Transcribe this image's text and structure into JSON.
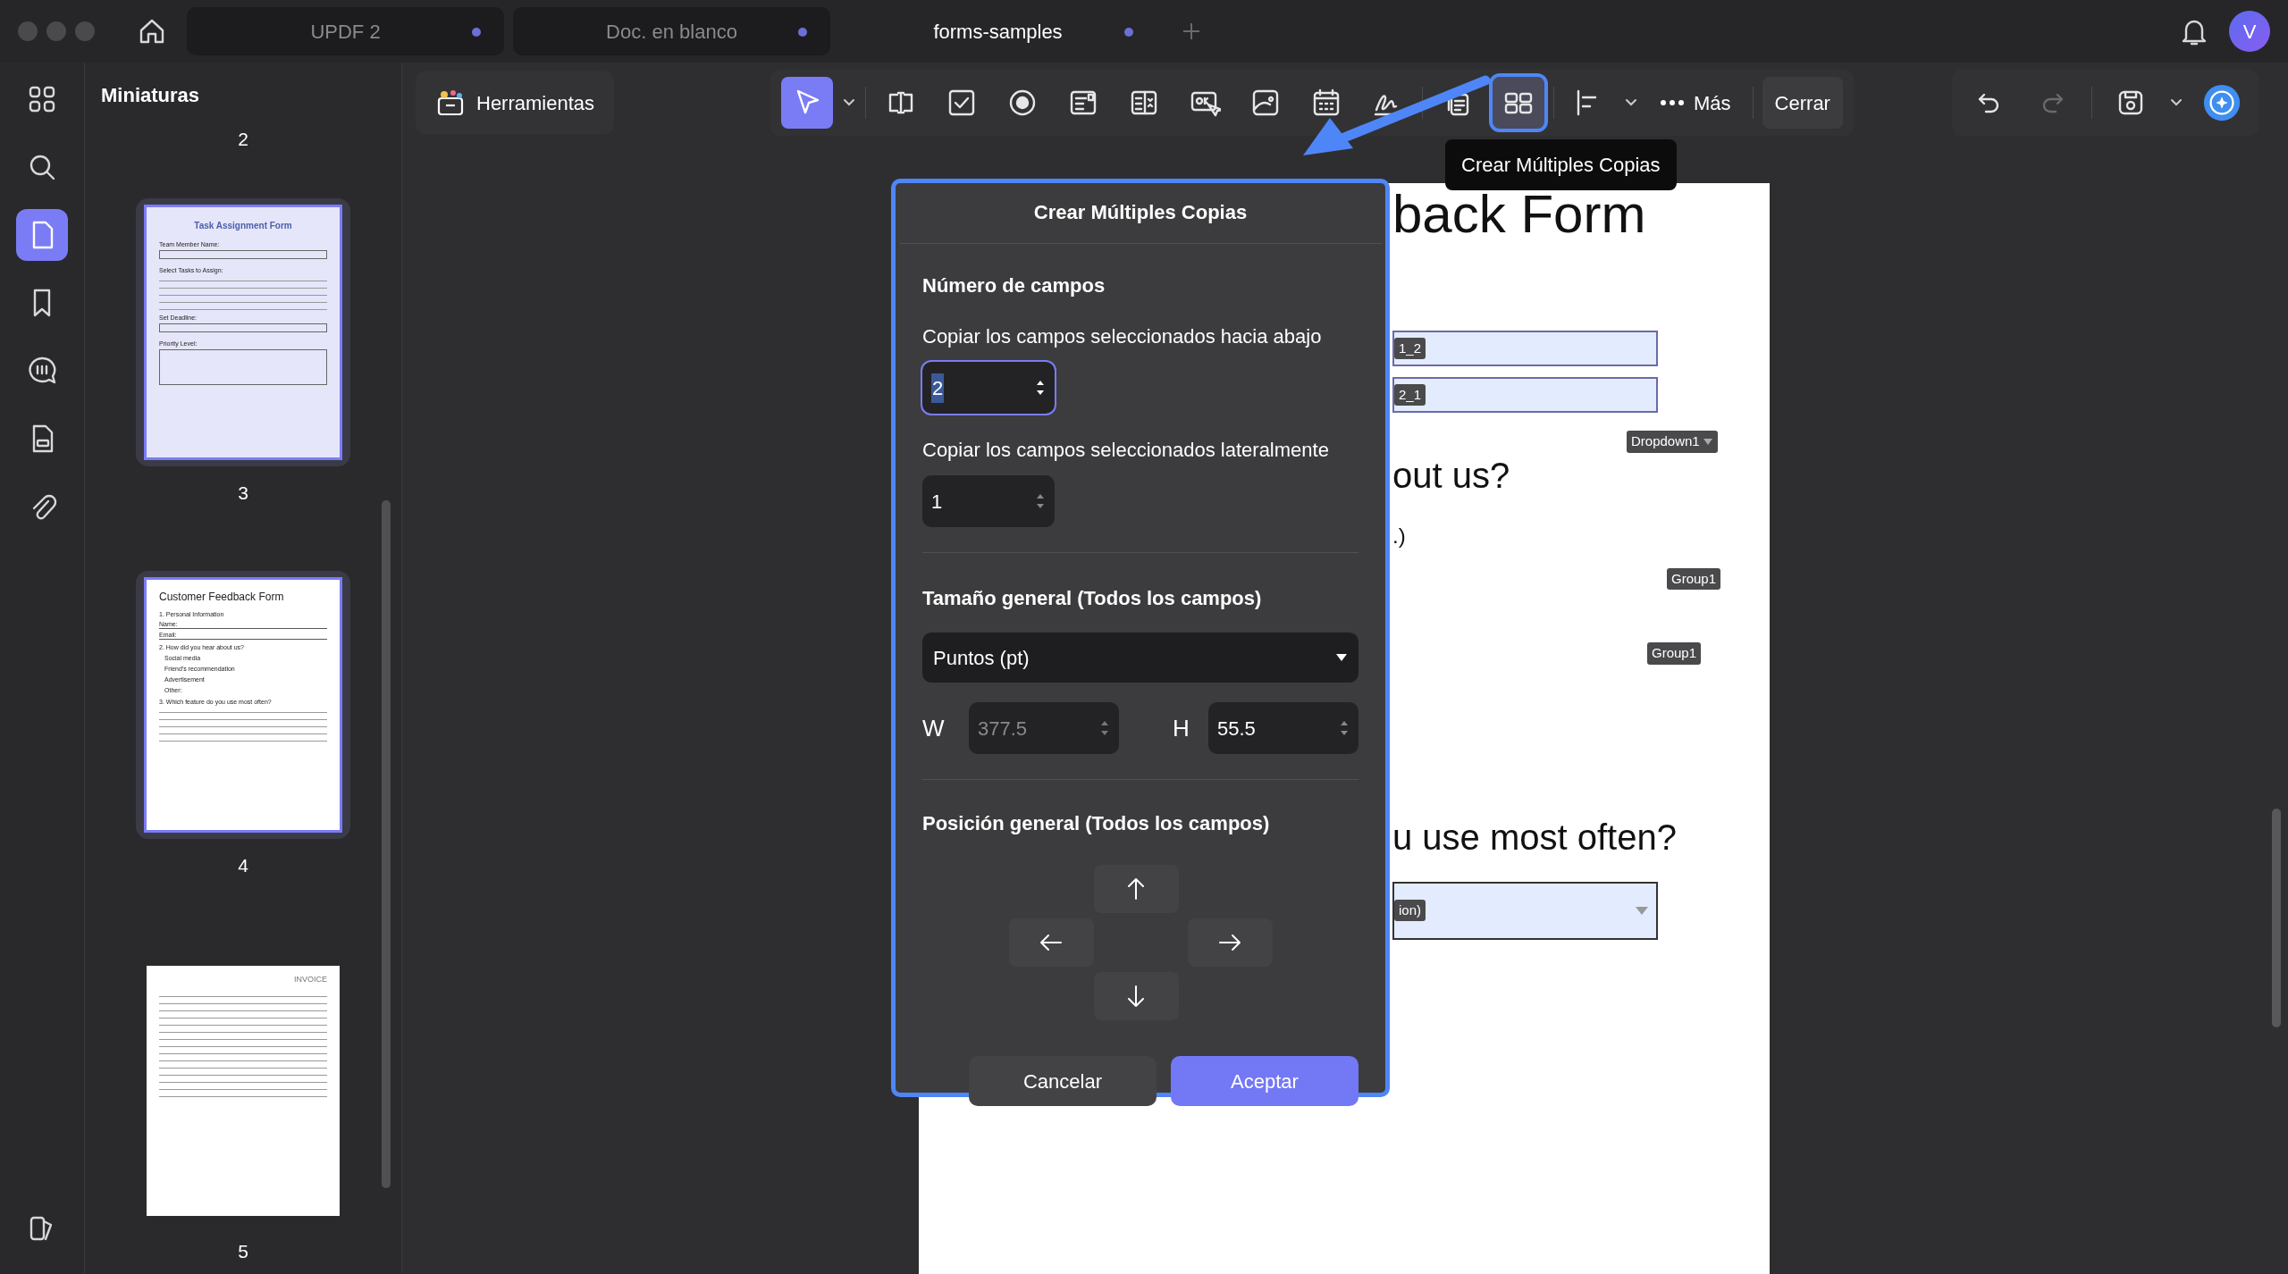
{
  "window": {
    "tabs": [
      {
        "label": "UPDF 2",
        "selected": false,
        "unsaved": true
      },
      {
        "label": "Doc. en blanco",
        "selected": false,
        "unsaved": true
      },
      {
        "label": "forms-samples",
        "selected": true,
        "unsaved": true
      }
    ],
    "avatar": "V"
  },
  "rail": [
    {
      "kind": "grid",
      "selected": false
    },
    {
      "kind": "search",
      "selected": false
    },
    {
      "kind": "page",
      "selected": true
    },
    {
      "kind": "bookmark",
      "selected": false
    },
    {
      "kind": "comment",
      "selected": false
    },
    {
      "kind": "form",
      "selected": false
    },
    {
      "kind": "attach",
      "selected": false
    },
    {
      "kind": "layers",
      "selected": false
    }
  ],
  "sidebar": {
    "title": "Miniaturas",
    "page_above": "2",
    "thumbnails": [
      {
        "page": "3",
        "selected": true,
        "texts": [
          {
            "kind": "title",
            "text": "Task Assignment Form"
          },
          {
            "kind": "label",
            "text": "Team Member Name:"
          },
          {
            "kind": "box"
          },
          {
            "kind": "label",
            "text": "Select Tasks to Assign:"
          },
          {
            "kind": "lines"
          },
          {
            "kind": "label",
            "text": "Set Deadline:"
          },
          {
            "kind": "box"
          },
          {
            "kind": "label",
            "text": "Priority Level:"
          },
          {
            "kind": "tallbox"
          }
        ]
      },
      {
        "page": "4",
        "selected": true,
        "texts": [
          {
            "kind": "heading",
            "text": "Customer Feedback Form"
          },
          {
            "kind": "text",
            "text": "1. Personal Information"
          },
          {
            "kind": "field",
            "text": "Name:"
          },
          {
            "kind": "field",
            "text": "Email:"
          },
          {
            "kind": "text",
            "text": "2. How did you hear about us?"
          },
          {
            "kind": "option",
            "text": "Social media"
          },
          {
            "kind": "option",
            "text": "Friend's recommendation"
          },
          {
            "kind": "option",
            "text": "Advertisement"
          },
          {
            "kind": "option",
            "text": "Other:"
          },
          {
            "kind": "text",
            "text": "3. Which feature do you use most often?"
          },
          {
            "kind": "lines"
          }
        ]
      },
      {
        "page": "5",
        "selected": false,
        "texts": [
          {
            "kind": "invoice",
            "text": "INVOICE"
          },
          {
            "kind": "lines"
          },
          {
            "kind": "lines"
          },
          {
            "kind": "lines"
          }
        ]
      }
    ]
  },
  "toolbar": {
    "tools_label": "Herramientas",
    "tools": [
      {
        "kind": "select",
        "selected": true,
        "focused": false
      },
      {
        "kind": "text_field",
        "selected": false,
        "focused": false
      },
      {
        "kind": "checkbox",
        "selected": false,
        "focused": false
      },
      {
        "kind": "radio",
        "selected": false,
        "focused": false
      },
      {
        "kind": "combo",
        "selected": false,
        "focused": false
      },
      {
        "kind": "list",
        "selected": false,
        "focused": false
      },
      {
        "kind": "button",
        "selected": false,
        "focused": false
      },
      {
        "kind": "image",
        "selected": false,
        "focused": false
      },
      {
        "kind": "date",
        "selected": false,
        "focused": false
      },
      {
        "kind": "signature",
        "selected": false,
        "focused": false
      },
      {
        "kind": "copy",
        "selected": false,
        "focused": false
      },
      {
        "kind": "multi_copy",
        "selected": false,
        "focused": true
      },
      {
        "kind": "align",
        "selected": false,
        "focused": false
      }
    ],
    "more": "Más",
    "close": "Cerrar",
    "tooltip": "Crear Múltiples Copias"
  },
  "document": {
    "title": "back Form",
    "fields": [
      {
        "tag": "1_2"
      },
      {
        "tag": "2_1"
      }
    ],
    "dropdown_tag": "Dropdown1",
    "question_2": "out us?",
    "note": ".)",
    "groups": [
      {
        "tag": "Group1"
      },
      {
        "tag": "Group1"
      }
    ],
    "question_3": "u use most often?",
    "select_tag": "ion)"
  },
  "dialog": {
    "title": "Crear Múltiples Copias",
    "count_heading": "Número de campos",
    "down_label": "Copiar los campos seleccionados hacia abajo",
    "down_value": "2",
    "down_focused": true,
    "side_label": "Copiar los campos seleccionados lateralmente",
    "side_value": "1",
    "side_focused": false,
    "size_heading": "Tamaño general (Todos los campos)",
    "unit": "Puntos (pt)",
    "w_label": "W",
    "w_value": "377.5",
    "w_disabled": true,
    "h_label": "H",
    "h_value": "55.5",
    "h_disabled": false,
    "position_heading": "Posición general (Todos los campos)",
    "cancel": "Cancelar",
    "accept": "Aceptar"
  }
}
